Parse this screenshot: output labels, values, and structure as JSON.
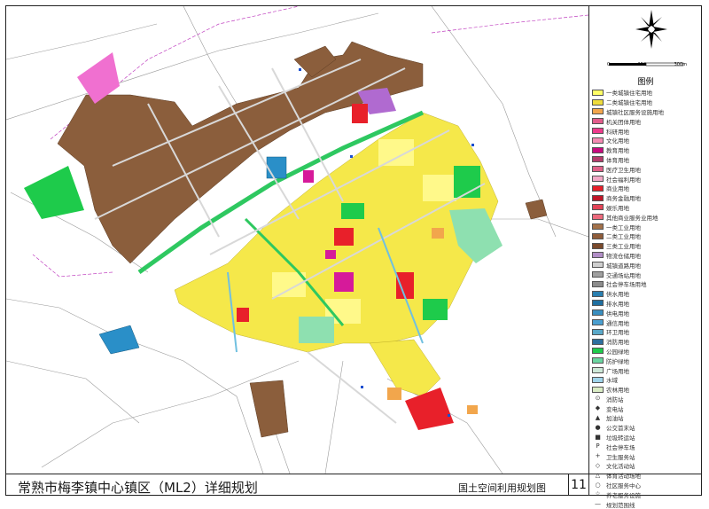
{
  "title": "常熟市梅李镇中心镇区（ML2）详细规划",
  "map_title": "国土空间利用规划图",
  "sheet_number": "11",
  "legend": {
    "heading": "图例",
    "items": [
      {
        "label": "一类城镇住宅用地",
        "color": "#ffff66"
      },
      {
        "label": "二类城镇住宅用地",
        "color": "#eedc3c"
      },
      {
        "label": "城镇社区服务设施用地",
        "color": "#f2a64c"
      },
      {
        "label": "机关团体用地",
        "color": "#e25d8c"
      },
      {
        "label": "科研用地",
        "color": "#ee3b8c"
      },
      {
        "label": "文化用地",
        "color": "#f58bb3"
      },
      {
        "label": "教育用地",
        "color": "#c80a7e"
      },
      {
        "label": "体育用地",
        "color": "#b43c6c"
      },
      {
        "label": "医疗卫生用地",
        "color": "#e06088"
      },
      {
        "label": "社会福利用地",
        "color": "#f3a8c6"
      },
      {
        "label": "商业用地",
        "color": "#e8202a"
      },
      {
        "label": "商务金融用地",
        "color": "#c01628"
      },
      {
        "label": "娱乐用地",
        "color": "#e34457"
      },
      {
        "label": "其他商业服务业用地",
        "color": "#ec6a7c"
      },
      {
        "label": "一类工业用地",
        "color": "#a3714a"
      },
      {
        "label": "二类工业用地",
        "color": "#8f5c3a"
      },
      {
        "label": "三类工业用地",
        "color": "#7a4a2c"
      },
      {
        "label": "物流仓储用地",
        "color": "#b18ec6"
      },
      {
        "label": "城镇道路用地",
        "color": "#cfcfcf"
      },
      {
        "label": "交通场站用地",
        "color": "#a0a0a0"
      },
      {
        "label": "社会停车场用地",
        "color": "#8c8c8c"
      },
      {
        "label": "供水用地",
        "color": "#2a7fb0"
      },
      {
        "label": "排水用地",
        "color": "#1f6fa0"
      },
      {
        "label": "供电用地",
        "color": "#3a8fc0"
      },
      {
        "label": "通信用地",
        "color": "#4a9fd0"
      },
      {
        "label": "环卫用地",
        "color": "#5aa8c8"
      },
      {
        "label": "消防用地",
        "color": "#2e6f9e"
      },
      {
        "label": "公园绿地",
        "color": "#1ecb4b"
      },
      {
        "label": "防护绿地",
        "color": "#6ad6a0"
      },
      {
        "label": "广场用地",
        "color": "#cde8d8"
      },
      {
        "label": "水域",
        "color": "#9fd4ea"
      },
      {
        "label": "农林用地",
        "color": "#d9ecc4"
      }
    ],
    "symbols": [
      {
        "glyph": "⊙",
        "label": "消防站"
      },
      {
        "glyph": "◆",
        "label": "变电站"
      },
      {
        "glyph": "▲",
        "label": "加油站"
      },
      {
        "glyph": "●",
        "label": "公交首末站"
      },
      {
        "glyph": "■",
        "label": "垃圾转运站"
      },
      {
        "glyph": "P",
        "label": "社会停车场"
      },
      {
        "glyph": "+",
        "label": "卫生服务站"
      },
      {
        "glyph": "◇",
        "label": "文化活动站"
      },
      {
        "glyph": "△",
        "label": "体育活动场地"
      },
      {
        "glyph": "○",
        "label": "社区服务中心"
      },
      {
        "glyph": "☆",
        "label": "养老服务设施"
      },
      {
        "glyph": "—",
        "label": "规划范围线"
      }
    ]
  },
  "north_arrow_label": "N",
  "scale": {
    "labels": [
      "0",
      "150",
      "300m"
    ]
  },
  "colors": {
    "industry": "#8b5e3c",
    "residential": "#f5e84a",
    "green": "#1ecb4b",
    "commercial": "#e8202a",
    "water": "#2a8fc8",
    "road": "#d8d8d8",
    "river": "#70c0e0"
  }
}
